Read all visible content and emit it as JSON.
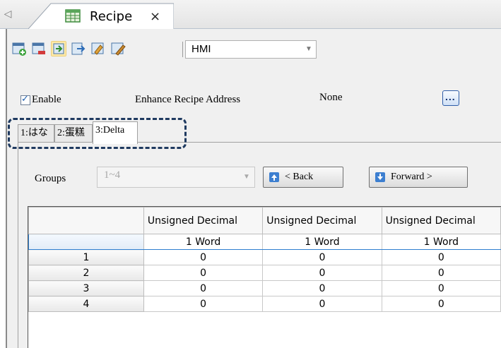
{
  "doc_tab": {
    "title": "Recipe",
    "close": "×",
    "scroll_left": "◁"
  },
  "toolbar": {
    "source_value": "HMI",
    "buttons": [
      "add-row-icon",
      "delete-row-icon",
      "import-icon",
      "export-icon",
      "paint-icon",
      "edit-icon"
    ]
  },
  "options": {
    "enable_label": "Enable",
    "enable_checked": true,
    "enhance_label": "Enhance Recipe Address",
    "enhance_value": "None",
    "browse_label": "..."
  },
  "subtabs": [
    {
      "label": "1:はな",
      "active": false
    },
    {
      "label": "2:蛋糕",
      "active": false
    },
    {
      "label": "3:Delta",
      "active": true
    }
  ],
  "groups": {
    "label": "Groups",
    "value": "1~4"
  },
  "nav": {
    "back_label": "< Back",
    "forward_label": "Forward >"
  },
  "table": {
    "columns": [
      "Unsigned Decimal",
      "Unsigned Decimal",
      "Unsigned Decimal"
    ],
    "size_row": [
      "1 Word",
      "1 Word",
      "1 Word"
    ],
    "rows": [
      {
        "label": "1",
        "values": [
          "0",
          "0",
          "0"
        ]
      },
      {
        "label": "2",
        "values": [
          "0",
          "0",
          "0"
        ]
      },
      {
        "label": "3",
        "values": [
          "0",
          "0",
          "0"
        ]
      },
      {
        "label": "4",
        "values": [
          "0",
          "0",
          "0"
        ]
      }
    ]
  },
  "colors": {
    "accent": "#2f7fd0",
    "highlight_box": "#1f3a60"
  }
}
